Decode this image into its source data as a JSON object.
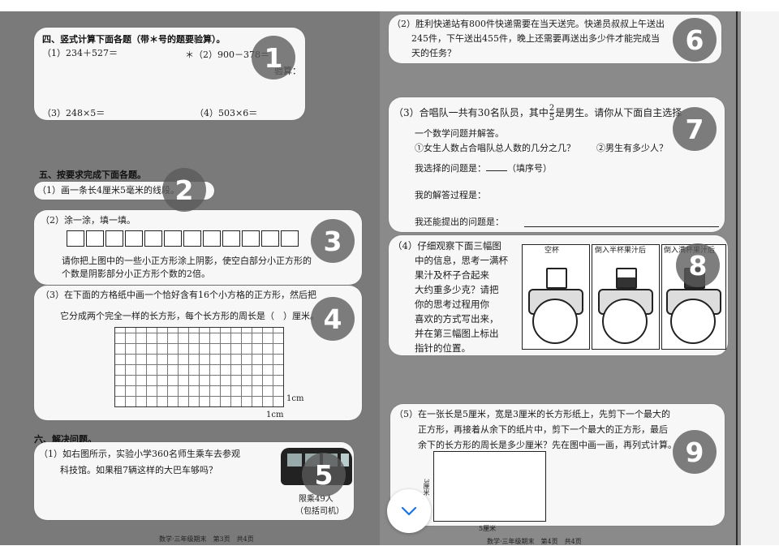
{
  "left_page": {
    "section4": {
      "heading": "四、竖式计算下面各题（带＊号的题要验算）。",
      "q1": "（1）234＋527＝",
      "q2": "＊（2）900－378＝",
      "q2_check": "验算：",
      "q3": "（3）248×5＝",
      "q4": "（4）503×6＝"
    },
    "section5": {
      "heading": "五、按要求完成下面各题。",
      "q1": "（1）画一条长4厘米5毫米的线段。",
      "q2_title": "（2）涂一涂，填一填。",
      "q2_text1": "请你把上图中的一些小正方形涂上阴影，使空白部分小正方形的",
      "q2_text2": "个数是阴影部分小正方形个数的2倍。",
      "q3_text1": "（3）在下面的方格纸中画一个恰好含有16个小方格的正方形，然后把",
      "q3_text2": "它分成两个完全一样的长方形，每个长方形的周长是（　）厘米。",
      "grid_unit_label1": "1cm",
      "grid_unit_label2": "1cm"
    },
    "section6": {
      "heading": "六、解决问题。",
      "q1_text1": "（1）如右图所示，实验小学360名师生乘车去参观",
      "q1_text2": "科技馆。如果租7辆这样的大巴车够吗？",
      "bus_label1": "限乘49人",
      "bus_label2": "（包括司机）"
    },
    "footer": "数学·三年级期末　第3页　共4页"
  },
  "right_page": {
    "q2_text1": "（2）胜利快递站有800件快递需要在当天送完。快递员叔叔上午送出",
    "q2_text2": "245件，下午送出455件，晚上还需要再送出多少件才能完成当",
    "q2_text3": "天的任务？",
    "q3_prefix": "（3）合唱队一共有30名队员，其中",
    "q3_frac_num": "2",
    "q3_frac_den": "5",
    "q3_suffix": "是男生。请你从下面自主选择",
    "q3_text2": "一个数学问题并解答。",
    "q3_opt1": "①女生人数占合唱队总人数的几分之几？",
    "q3_opt2": "②男生有多少人？",
    "q3_select": "我选择的问题是：",
    "q3_select_hint": "（填序号）",
    "q3_process": "我的解答过程是：",
    "q3_more": "我还能提出的问题是：",
    "q4_lines": [
      "（4）仔细观察下面三幅图",
      "中的信息，思考一满杯",
      "果汁及杯子合起来",
      "大约重多少克？请把",
      "你的思考过程用你",
      "喜欢的方式写出来，",
      "并在第三幅图上标出",
      "指针的位置。"
    ],
    "q4_panel_titles": [
      "空杯",
      "倒入半杯果汁后",
      "倒入满杯果汁后"
    ],
    "q5_text1": "（5）在一张长是5厘米，宽是3厘米的长方形纸上，先剪下一个最大的",
    "q5_text2": "正方形，再接着从余下的纸片中，剪下一个最大的正方形，最后",
    "q5_text3": "余下的长方形的周长是多少厘米？先在图中画一画，再列式计算。",
    "q5_width_label": "3厘米",
    "q5_length_label": "5厘米",
    "footer": "数学·三年级期末　第4页　共4页"
  },
  "badges": [
    "1",
    "2",
    "3",
    "4",
    "5",
    "6",
    "7",
    "8",
    "9"
  ],
  "scroll_button_icon": "chevron-down-icon"
}
